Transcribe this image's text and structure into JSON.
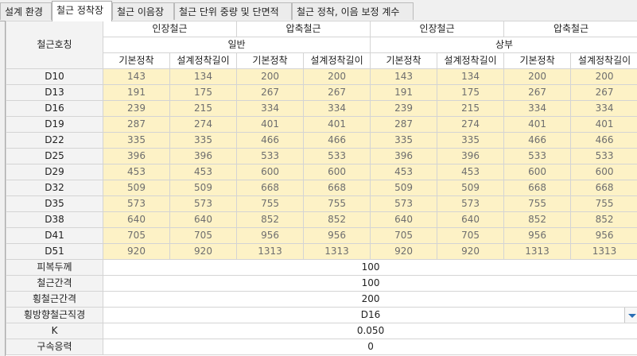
{
  "tabs": [
    {
      "label": "설계 환경",
      "active": false
    },
    {
      "label": "철근 정착장",
      "active": true
    },
    {
      "label": "철근 이음장",
      "active": false
    },
    {
      "label": "철근 단위 중량 및 단면적",
      "active": false
    },
    {
      "label": "철근 정착, 이음 보정 계수",
      "active": false
    }
  ],
  "table": {
    "corner_label": "철근호칭",
    "group_headers": [
      "인장철근",
      "압축철근",
      "인장철근",
      "압축철근"
    ],
    "position_headers": [
      "일반",
      "상부"
    ],
    "sub_headers": [
      "기본정착",
      "설계정착길이",
      "기본정착",
      "설계정착길이",
      "기본정착",
      "설계정착길이",
      "기본정착",
      "설계정착길이"
    ],
    "rows": [
      {
        "label": "D10",
        "values": [
          "143",
          "134",
          "200",
          "200",
          "143",
          "134",
          "200",
          "200"
        ]
      },
      {
        "label": "D13",
        "values": [
          "191",
          "175",
          "267",
          "267",
          "191",
          "175",
          "267",
          "267"
        ]
      },
      {
        "label": "D16",
        "values": [
          "239",
          "215",
          "334",
          "334",
          "239",
          "215",
          "334",
          "334"
        ]
      },
      {
        "label": "D19",
        "values": [
          "287",
          "274",
          "401",
          "401",
          "287",
          "274",
          "401",
          "401"
        ]
      },
      {
        "label": "D22",
        "values": [
          "335",
          "335",
          "466",
          "466",
          "335",
          "335",
          "466",
          "466"
        ]
      },
      {
        "label": "D25",
        "values": [
          "396",
          "396",
          "533",
          "533",
          "396",
          "396",
          "533",
          "533"
        ]
      },
      {
        "label": "D29",
        "values": [
          "453",
          "453",
          "600",
          "600",
          "453",
          "453",
          "600",
          "600"
        ]
      },
      {
        "label": "D32",
        "values": [
          "509",
          "509",
          "668",
          "668",
          "509",
          "509",
          "668",
          "668"
        ]
      },
      {
        "label": "D35",
        "values": [
          "573",
          "573",
          "755",
          "755",
          "573",
          "573",
          "755",
          "755"
        ]
      },
      {
        "label": "D38",
        "values": [
          "640",
          "640",
          "852",
          "852",
          "640",
          "640",
          "852",
          "852"
        ]
      },
      {
        "label": "D41",
        "values": [
          "705",
          "705",
          "956",
          "956",
          "705",
          "705",
          "956",
          "956"
        ]
      },
      {
        "label": "D51",
        "values": [
          "920",
          "920",
          "1313",
          "1313",
          "920",
          "920",
          "1313",
          "1313"
        ]
      }
    ],
    "params": [
      {
        "label": "피복두께",
        "value": "100"
      },
      {
        "label": "철근간격",
        "value": "100"
      },
      {
        "label": "횡철근간격",
        "value": "200"
      },
      {
        "label": "횡방향철근직경",
        "value": "D16",
        "dropdown": true
      },
      {
        "label": "K",
        "value": "0.050"
      },
      {
        "label": "구속응력",
        "value": "0"
      }
    ]
  },
  "colors": {
    "value_cell_bg": "#fdf2c6",
    "dropdown_arrow": "#2a6fb5"
  }
}
